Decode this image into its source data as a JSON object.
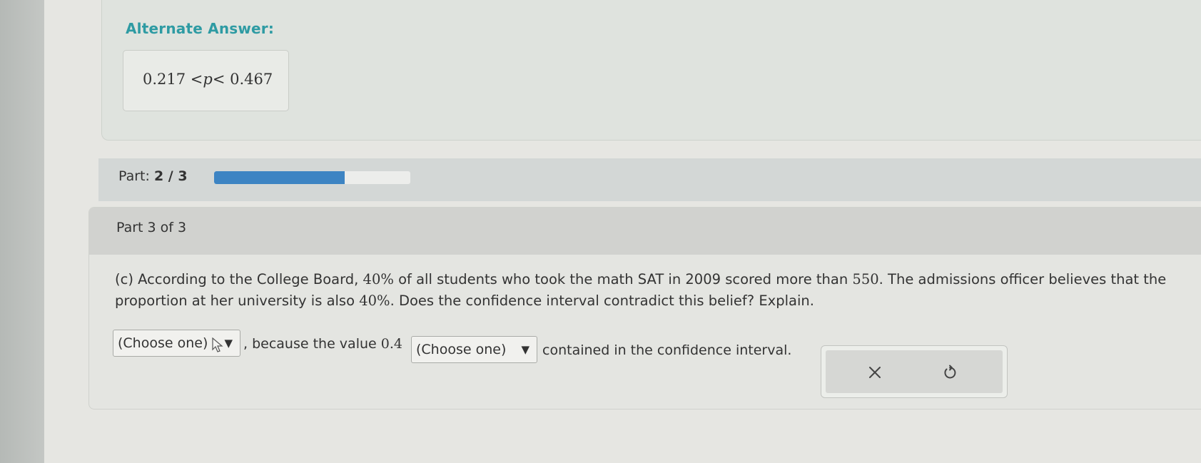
{
  "alternate": {
    "title": "Alternate Answer:",
    "expr_left": "0.217 <",
    "expr_var": "p",
    "expr_right": "< 0.467"
  },
  "progress": {
    "label_prefix": "Part:",
    "label_value": "2 / 3",
    "fraction": 0.667,
    "fill_color": "#3d84c3"
  },
  "question": {
    "header": "Part 3 of 3",
    "text_1": "(c) According to the College Board, ",
    "pct_1": "40%",
    "text_2": " of all students who took the math SAT in 2009 scored more than ",
    "num_550": "550",
    "text_3": ". The admissions officer believes that the proportion at her university is also ",
    "pct_2": "40%",
    "text_4": ". Does the confidence interval contradict this belief? Explain."
  },
  "answer_row": {
    "select_1": "(Choose one)",
    "middle_text": ", because the value ",
    "value": "0.4",
    "select_2": "(Choose one)",
    "end_text": "contained in the confidence interval.",
    "arrow": "▼"
  },
  "actions": {
    "clear_icon": "close-icon",
    "reset_icon": "undo-icon"
  }
}
